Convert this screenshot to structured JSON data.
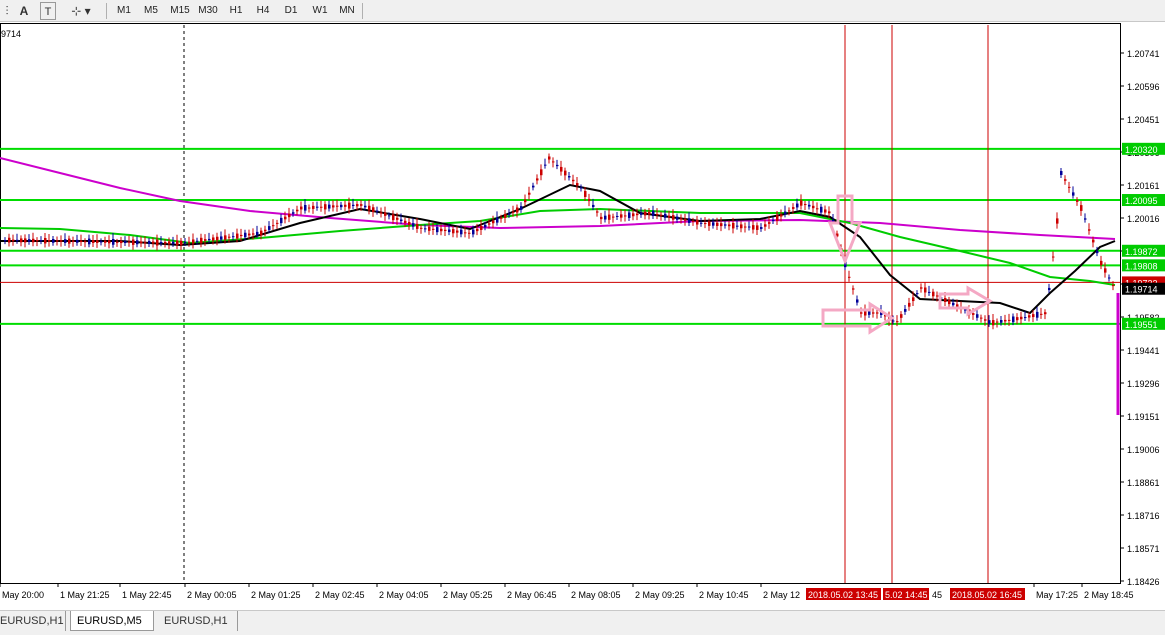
{
  "toolbar": {
    "icons": [
      {
        "name": "indicators-icon",
        "glyph": "⫶"
      },
      {
        "name": "text-tool-icon",
        "glyph": "A"
      },
      {
        "name": "text-label-icon",
        "glyph": "T"
      },
      {
        "name": "shapes-icon",
        "glyph": "⊹"
      }
    ],
    "timeframes": [
      "M1",
      "M5",
      "M15",
      "M30",
      "H1",
      "H4",
      "D1",
      "W1",
      "MN"
    ]
  },
  "chart": {
    "symbol_partial": "9714",
    "current_price": "1.19714",
    "price_axis_labels": [
      "1.20741",
      "1.20596",
      "1.20451",
      "1.20306",
      "1.20161",
      "1.20016",
      "1.19871",
      "1.19727",
      "1.19582",
      "1.19441",
      "1.19296",
      "1.19151",
      "1.19006",
      "1.18861",
      "1.18716",
      "1.18571",
      "1.18426"
    ],
    "hline_labels": [
      {
        "price": "1.20320",
        "color": "#00cc00"
      },
      {
        "price": "1.20095",
        "color": "#00cc00"
      },
      {
        "price": "1.19872",
        "color": "#00cc00"
      },
      {
        "price": "1.19808",
        "color": "#00cc00"
      },
      {
        "price": "1.19733",
        "color": "#cc0000"
      },
      {
        "price": "1.19714",
        "color": "#000000"
      },
      {
        "price": "1.19551",
        "color": "#00cc00"
      }
    ],
    "time_labels": [
      "May 20:00",
      "1 May 21:25",
      "1 May 22:45",
      "2 May 00:05",
      "2 May 01:25",
      "2 May 02:45",
      "2 May 04:05",
      "2 May 05:25",
      "2 May 06:45",
      "2 May 08:05",
      "2 May 09:25",
      "2 May 10:45",
      "2 May 12",
      "May 17:25",
      "2 May 18:45"
    ],
    "vline_labels": [
      "2018.05.02 13:45",
      "5.02 14:45",
      "2018.05.02 16:45"
    ],
    "time_label_after_vline": "45",
    "colors": {
      "bull": "#cc0000",
      "bear": "#000099",
      "ma_slow": "#cc00cc",
      "ma_mid": "#00cc00",
      "ma_fast": "#000000",
      "level": "#00dd00",
      "vline": "#cc0000",
      "arrow": "#f4a8c4"
    }
  },
  "tabs": [
    "EURUSD,H1",
    "EURUSD,M5",
    "EURUSD,H1"
  ],
  "active_tab": 1
}
